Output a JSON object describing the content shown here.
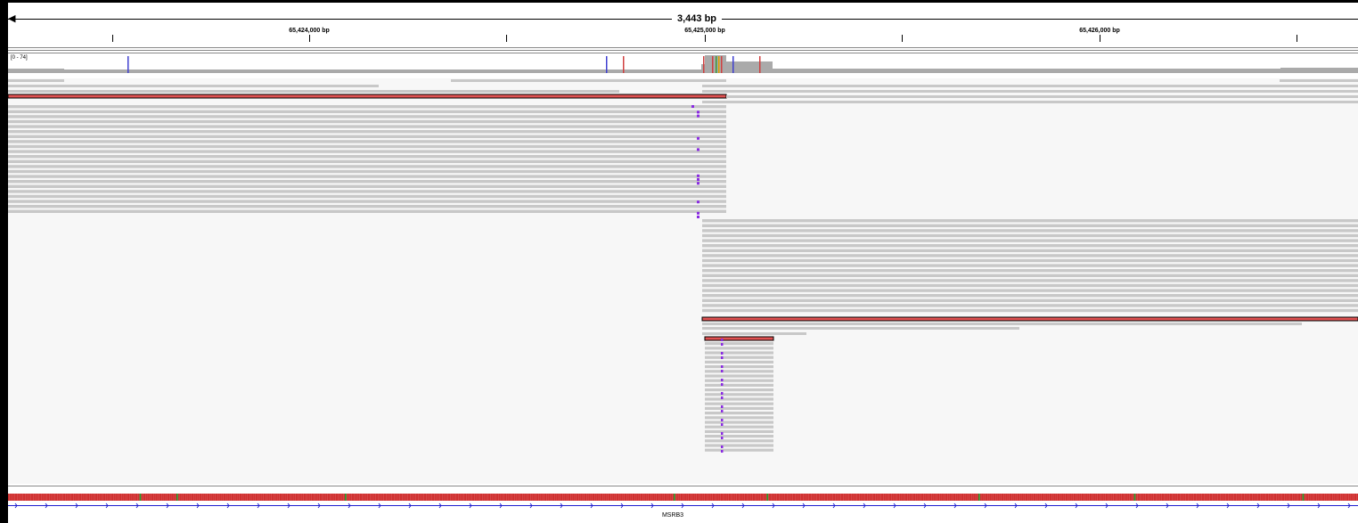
{
  "ruler": {
    "span": "3,443 bp",
    "span_arrow": "◀",
    "positions": [
      {
        "label": "65,424,000 bp"
      },
      {
        "label": "65,425,000 bp"
      },
      {
        "label": "65,426,000 bp"
      }
    ]
  },
  "coverage": {
    "range": "[0 - 74]"
  },
  "gene": {
    "name": "MSRB3"
  },
  "colors": {
    "read": "#c8c8c8",
    "highlighted_read": "#e05252",
    "insertion": "#8a2be2",
    "coverage": "#aaaaaa",
    "gene": "#1f1fd0"
  }
}
